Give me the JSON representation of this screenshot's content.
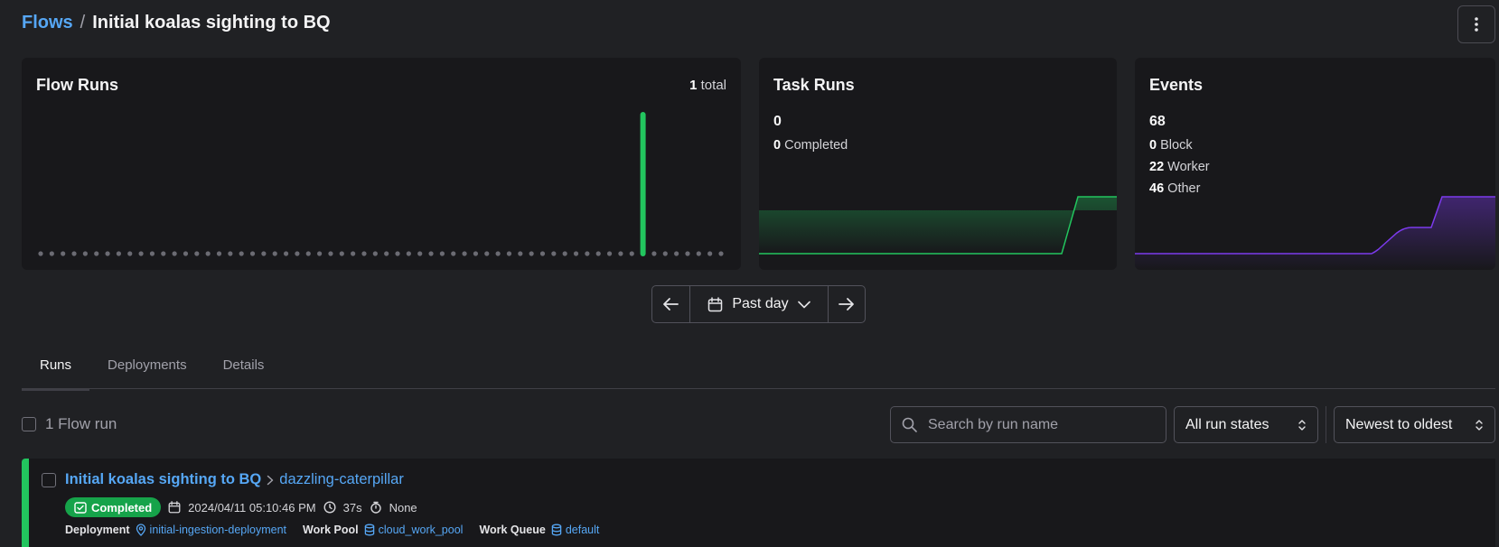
{
  "header": {
    "breadcrumb_root": "Flows",
    "breadcrumb_sep": "/",
    "breadcrumb_current": "Initial koalas sighting to BQ",
    "menu_icon": "kebab-menu-icon"
  },
  "flow_runs_card": {
    "title": "Flow Runs",
    "total_count": "1",
    "total_label": "total",
    "bar_count": 62,
    "run_index": 54,
    "bar_color": "#22c55e"
  },
  "task_runs_card": {
    "title": "Task Runs",
    "total": "0",
    "completed_count": "0",
    "completed_label": "Completed",
    "line_color": "#22c55e"
  },
  "events_card": {
    "title": "Events",
    "total": "68",
    "rows": [
      {
        "count": "0",
        "label": "Block"
      },
      {
        "count": "22",
        "label": "Worker"
      },
      {
        "count": "46",
        "label": "Other"
      }
    ],
    "line_color": "#7c3aed"
  },
  "date_range": {
    "label": "Past day",
    "prev_icon": "arrow-left-icon",
    "next_icon": "arrow-right-icon",
    "calendar_icon": "calendar-icon"
  },
  "tabs": [
    {
      "label": "Runs",
      "active": true
    },
    {
      "label": "Deployments",
      "active": false
    },
    {
      "label": "Details",
      "active": false
    }
  ],
  "toolbar": {
    "count_label": "1 Flow run",
    "search_placeholder": "Search by run name",
    "state_filter": "All run states",
    "sort": "Newest to oldest"
  },
  "runs": [
    {
      "flow_name": "Initial koalas sighting to BQ",
      "run_name": "dazzling-caterpillar",
      "state": "Completed",
      "start_time": "2024/04/11 05:10:46 PM",
      "duration": "37s",
      "task_runs": "None",
      "deployment_label": "Deployment",
      "deployment": "initial-ingestion-deployment",
      "work_pool_label": "Work Pool",
      "work_pool": "cloud_work_pool",
      "work_queue_label": "Work Queue",
      "work_queue": "default"
    }
  ]
}
